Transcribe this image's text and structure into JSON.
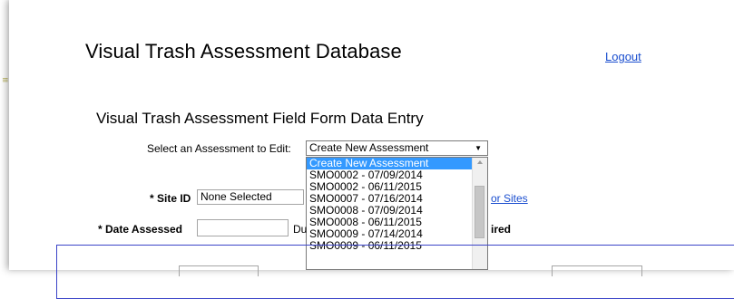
{
  "header": {
    "app_title": "Visual Trash Assessment Database",
    "logout_label": "Logout",
    "edge_mark": "≡"
  },
  "form": {
    "title": "Visual Trash Assessment Field Form Data Entry",
    "select_label": "Select an Assessment to Edit:",
    "select_value": "Create New Assessment",
    "select_arrow": "▼",
    "site_id_label": "* Site ID",
    "site_id_value": "None Selected",
    "site_link_fragment": "or Sites",
    "date_label": "* Date Assessed",
    "date_value": "",
    "du_fragment": "Du",
    "required_fragment": "ired"
  },
  "dropdown": {
    "options": [
      "Create New Assessment",
      "SMO0002 - 07/09/2014",
      "SMO0002 - 06/11/2015",
      "SMO0007 - 07/16/2014",
      "SMO0008 - 07/09/2014",
      "SMO0008 - 06/11/2015",
      "SMO0009 - 07/14/2014",
      "SMO0009 - 06/11/2015"
    ],
    "selected_index": 0
  },
  "colors": {
    "selection": "#3399ff",
    "link": "#1a4ecf",
    "frame_border": "#3b44c8"
  }
}
